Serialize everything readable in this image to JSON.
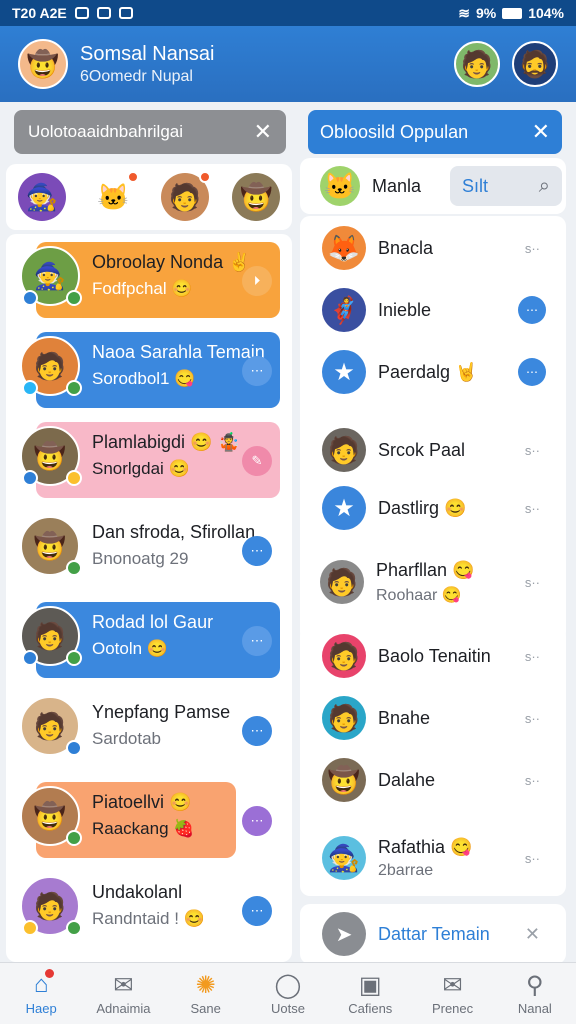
{
  "status_bar": {
    "time": "T20 A2E",
    "battery": "104%",
    "signal": "9%"
  },
  "header": {
    "name": "Somsal Nansai",
    "subtitle": "6Oomedr Nupal"
  },
  "left_search": {
    "text": "Uolotoaaidnbahrilgai"
  },
  "stories": [
    "warrior-avatar",
    "cat-sticker",
    "man-avatar",
    "hat-avatar"
  ],
  "chats": [
    {
      "name": "Obroolay Nonda ✌",
      "sub": "Fodfpchal 😊",
      "bubble": "#f8a33d",
      "action": "#f7b15b",
      "action_icon": "⏵"
    },
    {
      "name": "Naoa Sarahla Temain",
      "sub": "Sorodbol1 😋",
      "bubble": "#3b88de",
      "action": "#5a9be6",
      "action_icon": "⋯"
    },
    {
      "name": "Plamlabigdi 😊 🤹",
      "sub": "Snorlgdai 😊",
      "bubble": "#f8b8c8",
      "action": "#f08aaa",
      "action_icon": "✎"
    },
    {
      "name": "Dan sfroda, Sfirollan",
      "sub": "Bnonoatg 29",
      "bubble": "",
      "action": "#3b88de",
      "action_icon": "⋯"
    },
    {
      "name": "Rodad lol Gaur",
      "sub": "Ootoln 😊",
      "bubble": "#3b88de",
      "action": "#5a9be6",
      "action_icon": "⋯"
    },
    {
      "name": "Ynepfang Pamse",
      "sub": "Sardotab",
      "bubble": "",
      "action": "#3b88de",
      "action_icon": "⋯"
    },
    {
      "name": "Piatoellvi 😊",
      "sub": "Raackang 🍓",
      "bubble": "#f9a370",
      "action": "#9b6fd6",
      "action_icon": "⋯"
    },
    {
      "name": "Undakolanl",
      "sub": "Randntaid ! 😊",
      "bubble": "",
      "action": "#3b88de",
      "action_icon": "⋯"
    }
  ],
  "right_search": {
    "text": "Obloosild Oppulan"
  },
  "right_filter": {
    "label": "Sılt",
    "icon": "search-icon"
  },
  "right_top_row": {
    "name": "Manla"
  },
  "contacts_group1": [
    {
      "name": "Bnacla",
      "meta": "s··"
    },
    {
      "name": "Inieble",
      "meta": "blue"
    },
    {
      "name": "Paerdalg 🤘",
      "meta": "blue"
    }
  ],
  "contacts_group2": [
    {
      "name": "Srcok Paal",
      "meta": "s··"
    },
    {
      "name": "Dastlirg 😊",
      "meta": "s··"
    }
  ],
  "contact_single": {
    "name": "Pharfllan 😋",
    "sub": "Roohaar 😋",
    "meta": "s··"
  },
  "contacts_group3": [
    {
      "name": "Baolo Tenaitin",
      "meta": "s··"
    },
    {
      "name": "Bnahe",
      "meta": "s··"
    },
    {
      "name": "Dalahe",
      "meta": "s··"
    }
  ],
  "contact_rara": {
    "name": "Rafathia 😋",
    "sub": "2barrae",
    "meta": "s··"
  },
  "daftar": {
    "label": "Dattar Temain"
  },
  "bottom_nav": [
    {
      "label": "Haep",
      "icon": "home-icon",
      "active": true
    },
    {
      "label": "Adnaimia",
      "icon": "map-icon",
      "active": false
    },
    {
      "label": "Sane",
      "icon": "sun-icon",
      "active": false
    },
    {
      "label": "Uotse",
      "icon": "circle-icon",
      "active": false
    },
    {
      "label": "Cafiens",
      "icon": "camera-icon",
      "active": false
    },
    {
      "label": "Prenec",
      "icon": "mail-icon",
      "active": false
    },
    {
      "label": "Nanal",
      "icon": "profile-icon",
      "active": false
    }
  ]
}
